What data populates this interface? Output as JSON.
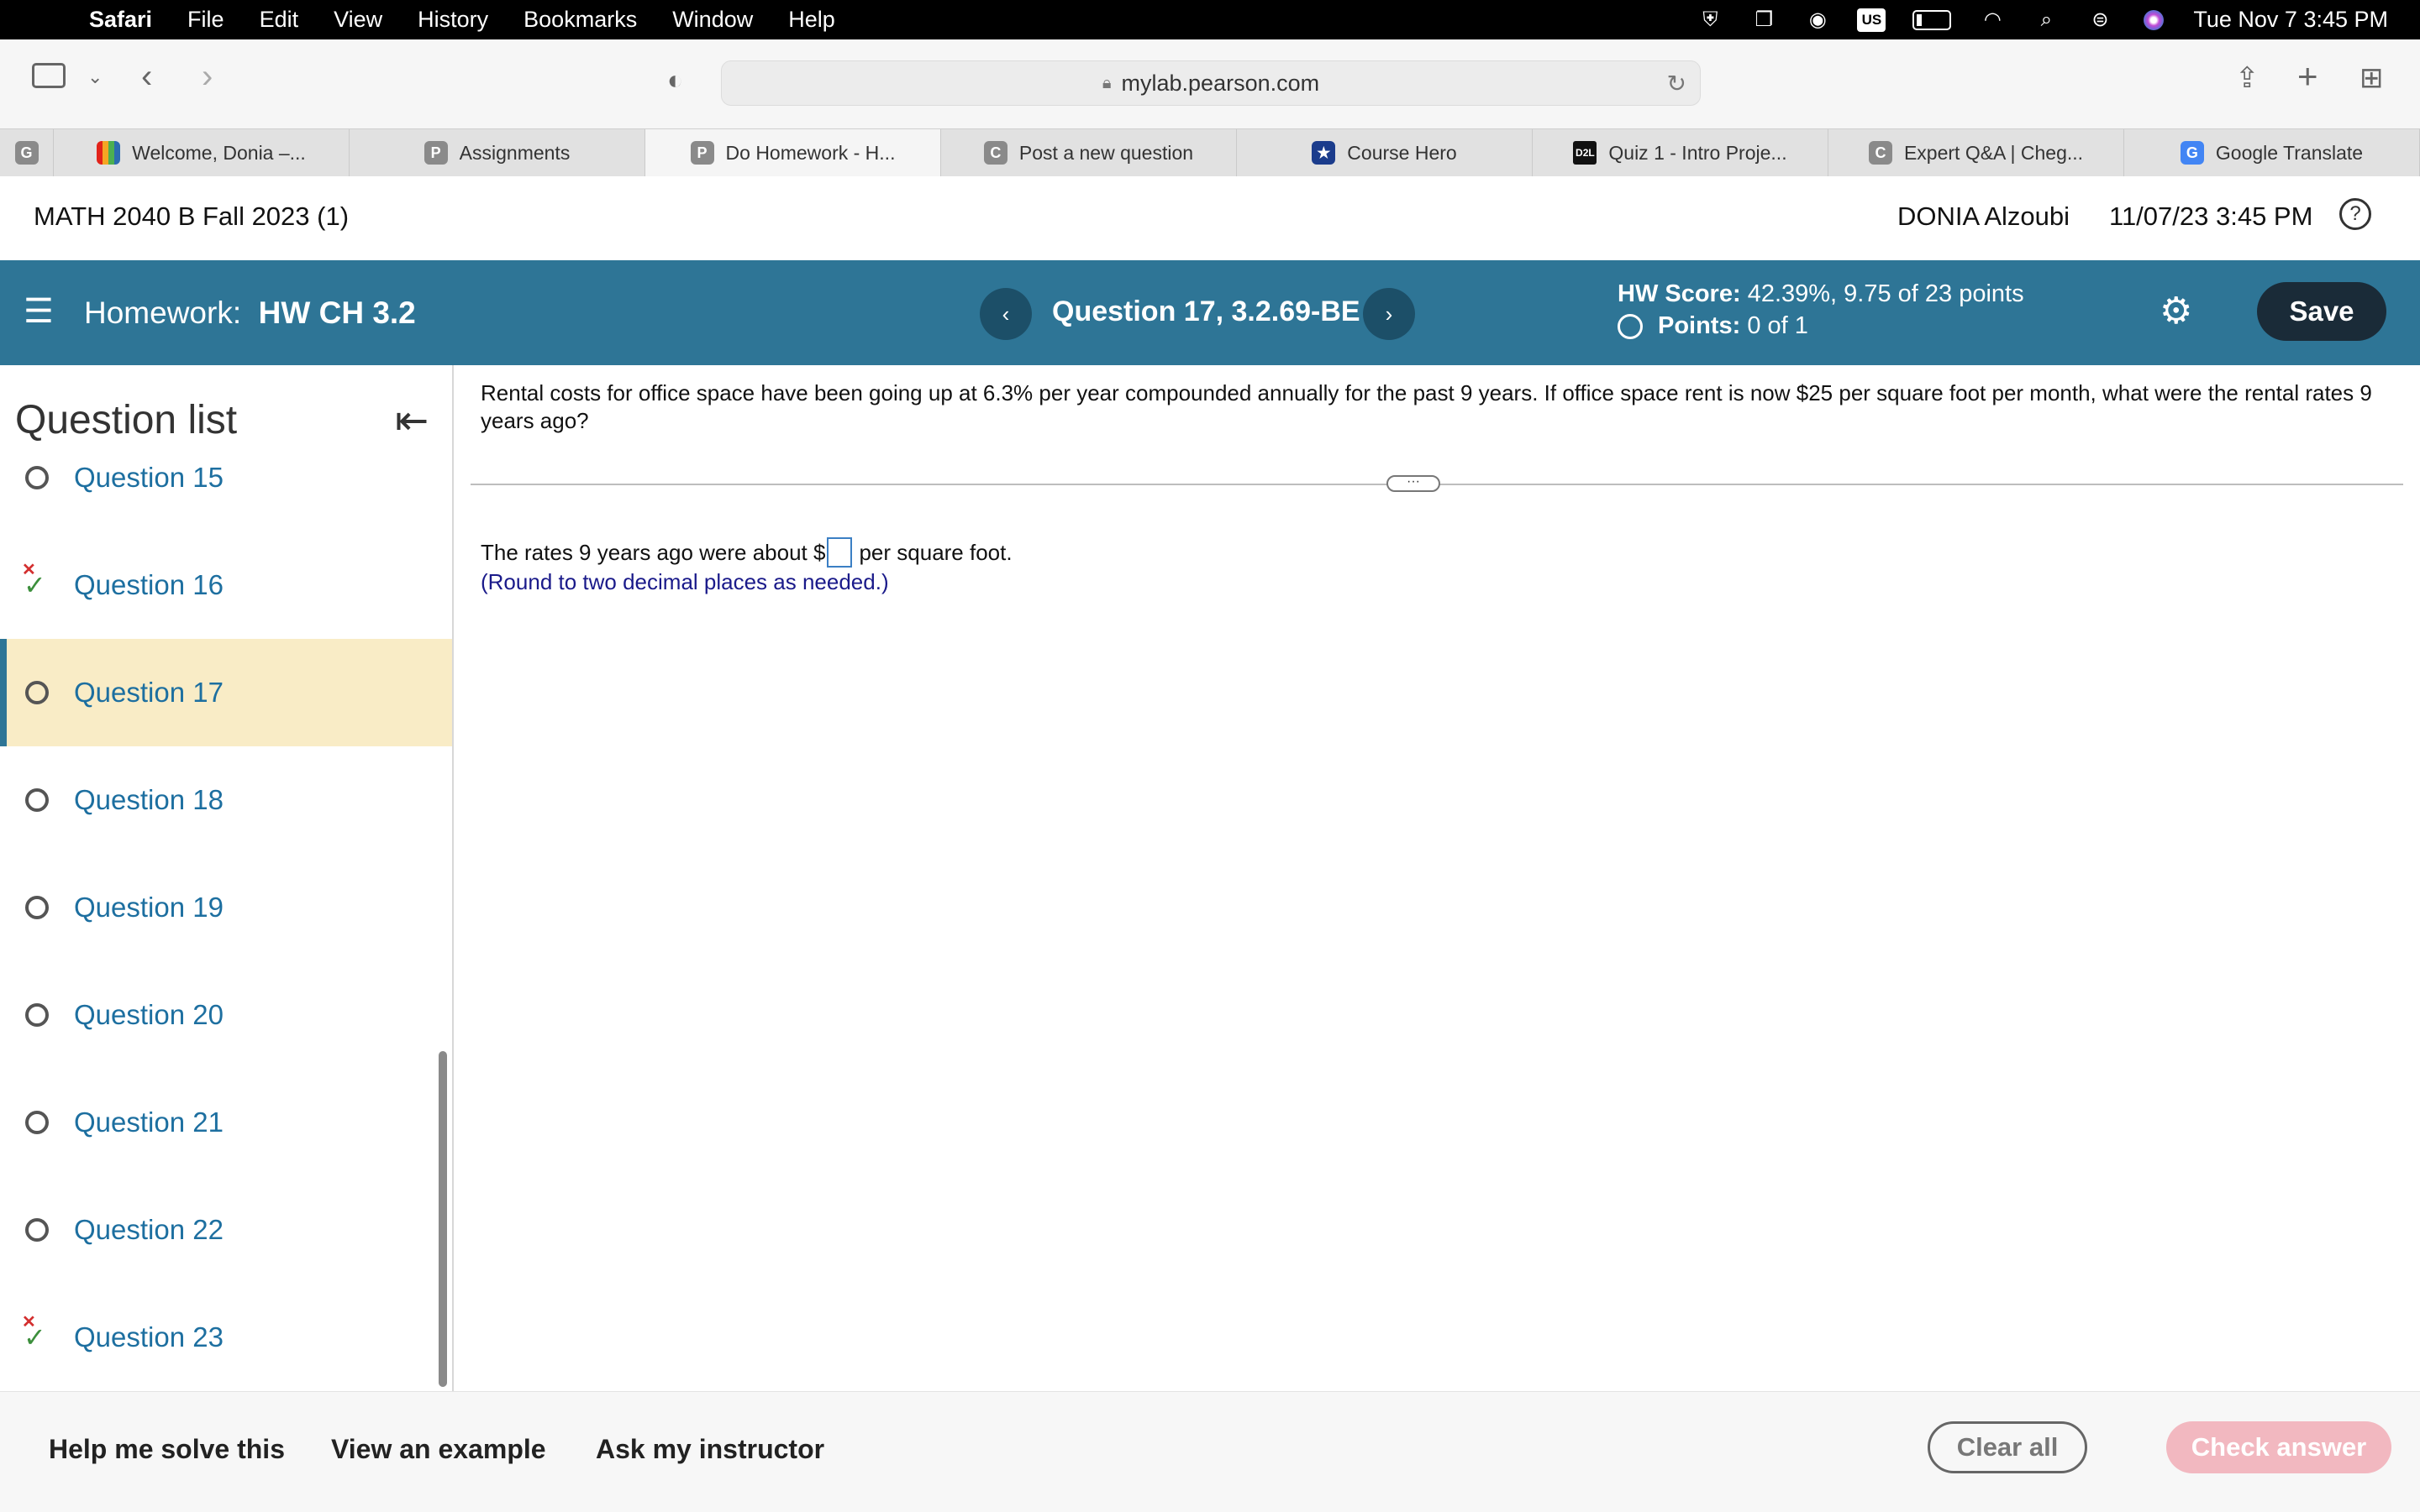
{
  "menubar": {
    "app": "Safari",
    "items": [
      "File",
      "Edit",
      "View",
      "History",
      "Bookmarks",
      "Window",
      "Help"
    ],
    "keyboard": "US",
    "clock": "Tue Nov 7  3:45 PM"
  },
  "browser": {
    "url": "mylab.pearson.com",
    "tabs": [
      {
        "icon": "G",
        "label": ""
      },
      {
        "icon": "",
        "label": "Welcome, Donia –..."
      },
      {
        "icon": "P",
        "label": "Assignments"
      },
      {
        "icon": "P",
        "label": "Do Homework - H..."
      },
      {
        "icon": "C",
        "label": "Post a new question"
      },
      {
        "icon": "★",
        "label": "Course Hero"
      },
      {
        "icon": "D2L",
        "label": "Quiz 1 - Intro Proje..."
      },
      {
        "icon": "C",
        "label": "Expert Q&A | Cheg..."
      },
      {
        "icon": "G",
        "label": "Google Translate"
      }
    ]
  },
  "course": {
    "title": "MATH 2040 B Fall 2023 (1)",
    "user": "DONIA Alzoubi",
    "datetime": "11/07/23 3:45 PM",
    "help": "?"
  },
  "homework": {
    "label": "Homework:",
    "name": "HW CH 3.2",
    "question_title": "Question 17, 3.2.69-BE",
    "score_label": "HW Score:",
    "score_value": "42.39%, 9.75 of 23 points",
    "points_label": "Points:",
    "points_value": "0 of 1",
    "save": "Save"
  },
  "sidebar": {
    "title": "Question list",
    "items": [
      {
        "label": "Question 15",
        "status": "unanswered"
      },
      {
        "label": "Question 16",
        "status": "partial"
      },
      {
        "label": "Question 17",
        "status": "current"
      },
      {
        "label": "Question 18",
        "status": "unanswered"
      },
      {
        "label": "Question 19",
        "status": "unanswered"
      },
      {
        "label": "Question 20",
        "status": "unanswered"
      },
      {
        "label": "Question 21",
        "status": "unanswered"
      },
      {
        "label": "Question 22",
        "status": "unanswered"
      },
      {
        "label": "Question 23",
        "status": "partial"
      }
    ]
  },
  "question": {
    "text": "Rental costs for office space have been going up at 6.3% per year compounded annually for the past 9 years. If office space rent is now $25 per square foot per month, what were the rental rates 9 years ago?",
    "answer_prefix": "The rates 9 years ago were about $",
    "answer_suffix": " per square foot.",
    "answer_value": "",
    "note": "(Round to two decimal places as needed.)"
  },
  "actions": {
    "help_solve": "Help me solve this",
    "view_example": "View an example",
    "ask_instructor": "Ask my instructor",
    "clear_all": "Clear all",
    "check_answer": "Check answer"
  },
  "colors": {
    "brand": "#2e7596",
    "current_row": "#f9ecc6",
    "link": "#1d6fa0",
    "check_disabled": "#f2b8c0"
  }
}
